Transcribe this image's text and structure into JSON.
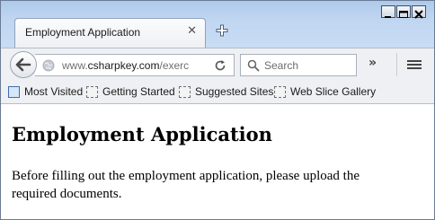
{
  "tab": {
    "title": "Employment Application"
  },
  "address_bar": {
    "url_prefix": "www.",
    "url_host": "csharpkey.com",
    "url_rest": "/exerc"
  },
  "search": {
    "placeholder": "Search"
  },
  "bookmarks": [
    {
      "label": "Most Visited"
    },
    {
      "label": "Getting Started"
    },
    {
      "label": "Suggested Sites"
    },
    {
      "label": "Web Slice Gallery"
    }
  ],
  "page": {
    "heading": "Employment Application",
    "paragraph": "Before filling out the employment application, please upload the required documents."
  }
}
